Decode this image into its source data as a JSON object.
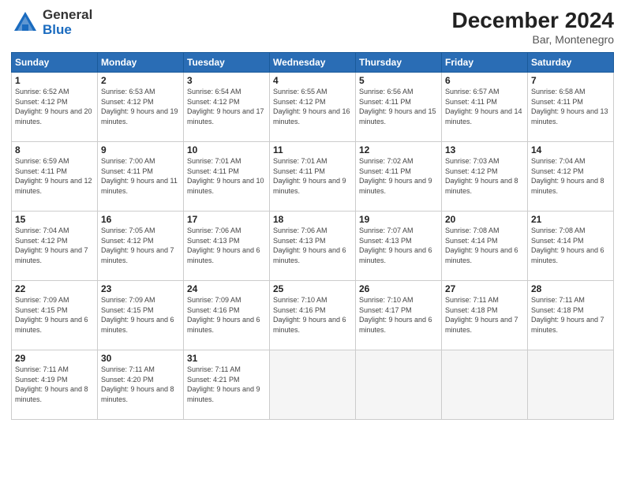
{
  "header": {
    "logo_general": "General",
    "logo_blue": "Blue",
    "title": "December 2024",
    "location": "Bar, Montenegro"
  },
  "weekdays": [
    "Sunday",
    "Monday",
    "Tuesday",
    "Wednesday",
    "Thursday",
    "Friday",
    "Saturday"
  ],
  "weeks": [
    [
      {
        "day": "1",
        "info": "Sunrise: 6:52 AM\nSunset: 4:12 PM\nDaylight: 9 hours and 20 minutes."
      },
      {
        "day": "2",
        "info": "Sunrise: 6:53 AM\nSunset: 4:12 PM\nDaylight: 9 hours and 19 minutes."
      },
      {
        "day": "3",
        "info": "Sunrise: 6:54 AM\nSunset: 4:12 PM\nDaylight: 9 hours and 17 minutes."
      },
      {
        "day": "4",
        "info": "Sunrise: 6:55 AM\nSunset: 4:12 PM\nDaylight: 9 hours and 16 minutes."
      },
      {
        "day": "5",
        "info": "Sunrise: 6:56 AM\nSunset: 4:11 PM\nDaylight: 9 hours and 15 minutes."
      },
      {
        "day": "6",
        "info": "Sunrise: 6:57 AM\nSunset: 4:11 PM\nDaylight: 9 hours and 14 minutes."
      },
      {
        "day": "7",
        "info": "Sunrise: 6:58 AM\nSunset: 4:11 PM\nDaylight: 9 hours and 13 minutes."
      }
    ],
    [
      {
        "day": "8",
        "info": "Sunrise: 6:59 AM\nSunset: 4:11 PM\nDaylight: 9 hours and 12 minutes."
      },
      {
        "day": "9",
        "info": "Sunrise: 7:00 AM\nSunset: 4:11 PM\nDaylight: 9 hours and 11 minutes."
      },
      {
        "day": "10",
        "info": "Sunrise: 7:01 AM\nSunset: 4:11 PM\nDaylight: 9 hours and 10 minutes."
      },
      {
        "day": "11",
        "info": "Sunrise: 7:01 AM\nSunset: 4:11 PM\nDaylight: 9 hours and 9 minutes."
      },
      {
        "day": "12",
        "info": "Sunrise: 7:02 AM\nSunset: 4:11 PM\nDaylight: 9 hours and 9 minutes."
      },
      {
        "day": "13",
        "info": "Sunrise: 7:03 AM\nSunset: 4:12 PM\nDaylight: 9 hours and 8 minutes."
      },
      {
        "day": "14",
        "info": "Sunrise: 7:04 AM\nSunset: 4:12 PM\nDaylight: 9 hours and 8 minutes."
      }
    ],
    [
      {
        "day": "15",
        "info": "Sunrise: 7:04 AM\nSunset: 4:12 PM\nDaylight: 9 hours and 7 minutes."
      },
      {
        "day": "16",
        "info": "Sunrise: 7:05 AM\nSunset: 4:12 PM\nDaylight: 9 hours and 7 minutes."
      },
      {
        "day": "17",
        "info": "Sunrise: 7:06 AM\nSunset: 4:13 PM\nDaylight: 9 hours and 6 minutes."
      },
      {
        "day": "18",
        "info": "Sunrise: 7:06 AM\nSunset: 4:13 PM\nDaylight: 9 hours and 6 minutes."
      },
      {
        "day": "19",
        "info": "Sunrise: 7:07 AM\nSunset: 4:13 PM\nDaylight: 9 hours and 6 minutes."
      },
      {
        "day": "20",
        "info": "Sunrise: 7:08 AM\nSunset: 4:14 PM\nDaylight: 9 hours and 6 minutes."
      },
      {
        "day": "21",
        "info": "Sunrise: 7:08 AM\nSunset: 4:14 PM\nDaylight: 9 hours and 6 minutes."
      }
    ],
    [
      {
        "day": "22",
        "info": "Sunrise: 7:09 AM\nSunset: 4:15 PM\nDaylight: 9 hours and 6 minutes."
      },
      {
        "day": "23",
        "info": "Sunrise: 7:09 AM\nSunset: 4:15 PM\nDaylight: 9 hours and 6 minutes."
      },
      {
        "day": "24",
        "info": "Sunrise: 7:09 AM\nSunset: 4:16 PM\nDaylight: 9 hours and 6 minutes."
      },
      {
        "day": "25",
        "info": "Sunrise: 7:10 AM\nSunset: 4:16 PM\nDaylight: 9 hours and 6 minutes."
      },
      {
        "day": "26",
        "info": "Sunrise: 7:10 AM\nSunset: 4:17 PM\nDaylight: 9 hours and 6 minutes."
      },
      {
        "day": "27",
        "info": "Sunrise: 7:11 AM\nSunset: 4:18 PM\nDaylight: 9 hours and 7 minutes."
      },
      {
        "day": "28",
        "info": "Sunrise: 7:11 AM\nSunset: 4:18 PM\nDaylight: 9 hours and 7 minutes."
      }
    ],
    [
      {
        "day": "29",
        "info": "Sunrise: 7:11 AM\nSunset: 4:19 PM\nDaylight: 9 hours and 8 minutes."
      },
      {
        "day": "30",
        "info": "Sunrise: 7:11 AM\nSunset: 4:20 PM\nDaylight: 9 hours and 8 minutes."
      },
      {
        "day": "31",
        "info": "Sunrise: 7:11 AM\nSunset: 4:21 PM\nDaylight: 9 hours and 9 minutes."
      },
      null,
      null,
      null,
      null
    ]
  ]
}
